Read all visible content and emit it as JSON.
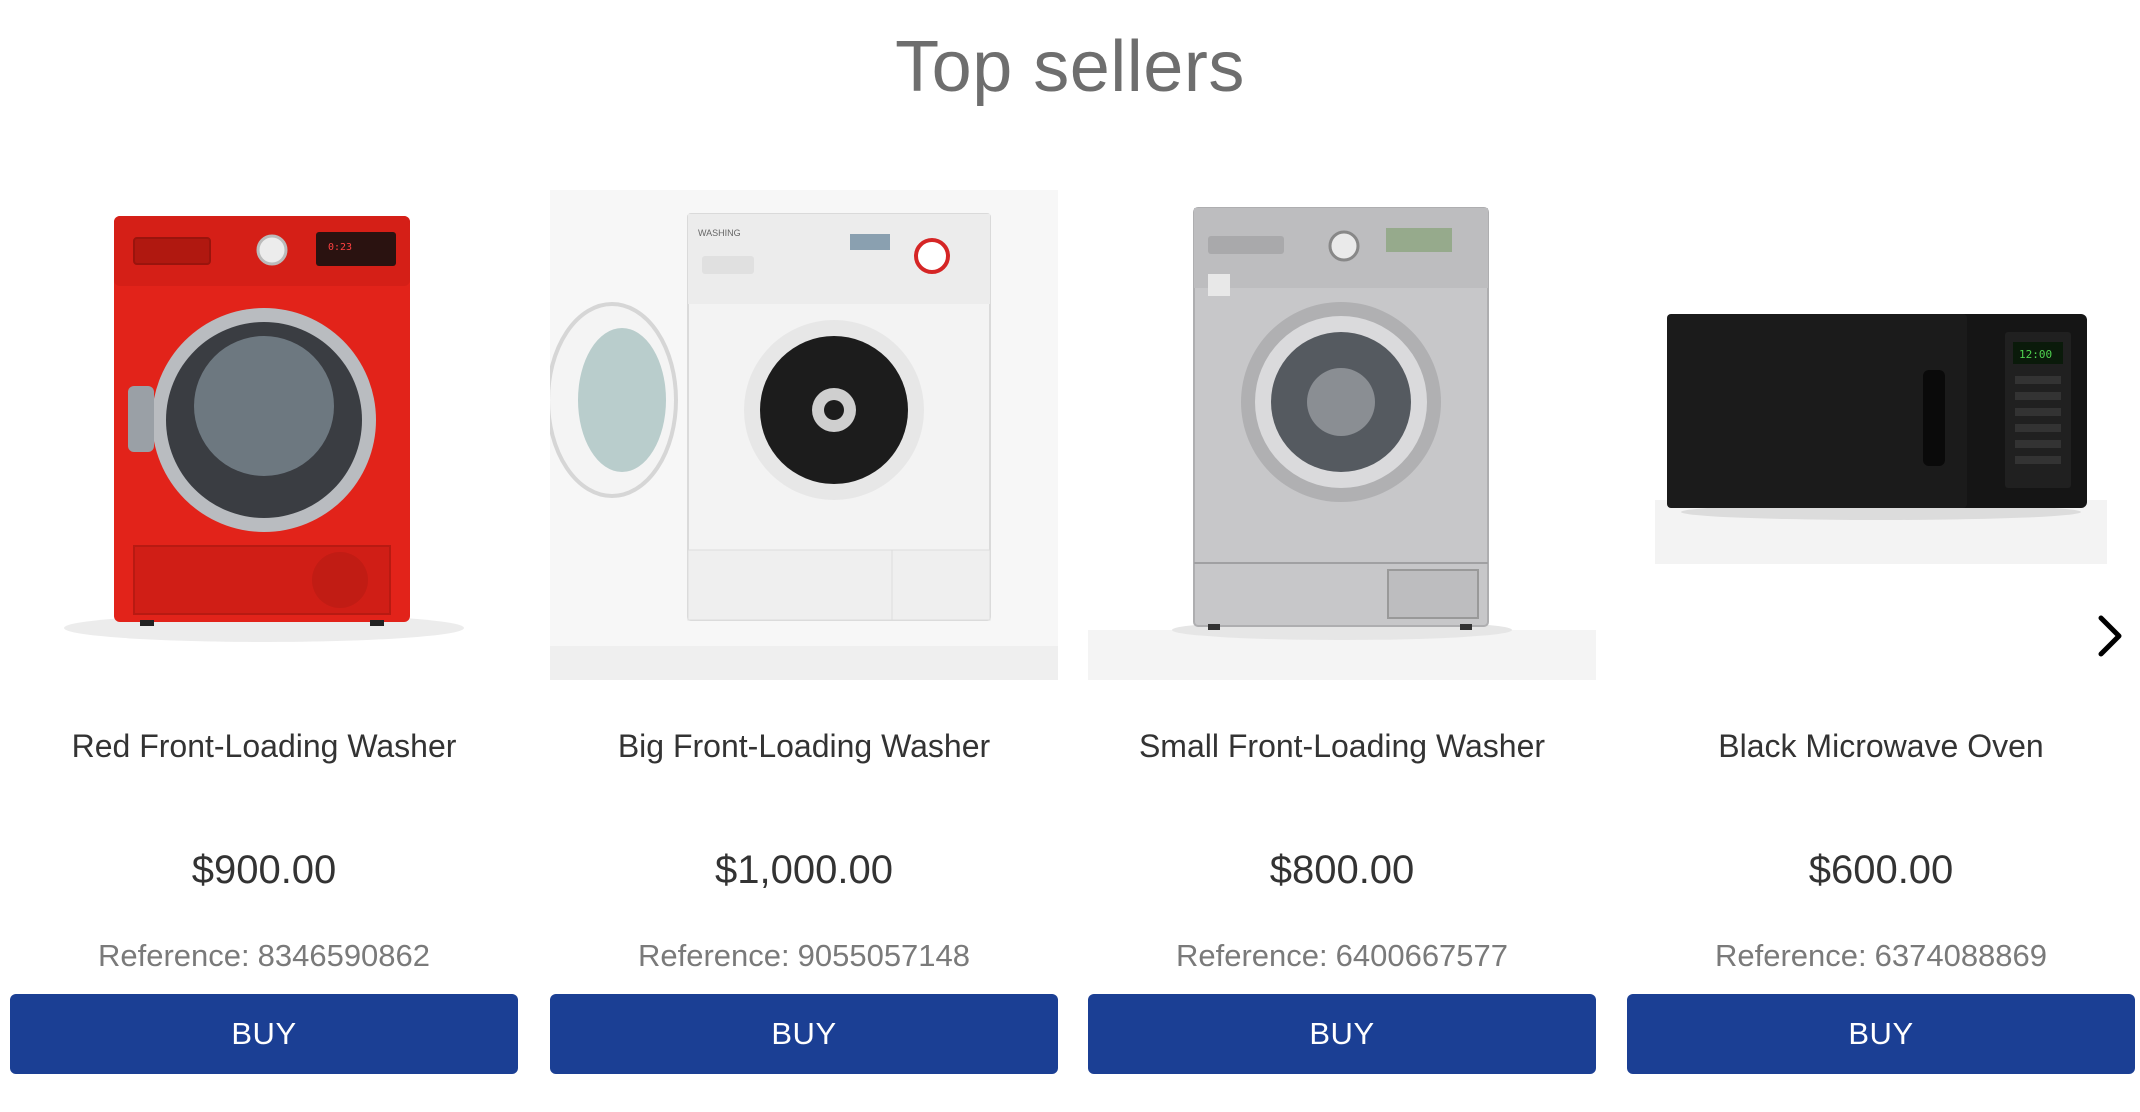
{
  "section": {
    "title": "Top sellers"
  },
  "carousel": {
    "prev_icon": "chevron-left-icon",
    "next_icon": "chevron-right-icon"
  },
  "products": [
    {
      "name": "Red Front-Loading Washer",
      "price": "$900.00",
      "reference_label": "Reference:",
      "reference": "8346590862",
      "buy_label": "BUY",
      "color": "#e2231a"
    },
    {
      "name": "Big Front-Loading Washer",
      "price": "$1,000.00",
      "reference_label": "Reference:",
      "reference": "9055057148",
      "buy_label": "BUY",
      "color": "#f2f2f2"
    },
    {
      "name": "Small Front-Loading Washer",
      "price": "$800.00",
      "reference_label": "Reference:",
      "reference": "6400667577",
      "buy_label": "BUY",
      "color": "#c7c7c9"
    },
    {
      "name": "Black Microwave Oven",
      "price": "$600.00",
      "reference_label": "Reference:",
      "reference": "6374088869",
      "buy_label": "BUY",
      "color": "#151515"
    }
  ],
  "theme": {
    "button_color": "#1b3f94",
    "title_color": "#6e6e6e"
  }
}
